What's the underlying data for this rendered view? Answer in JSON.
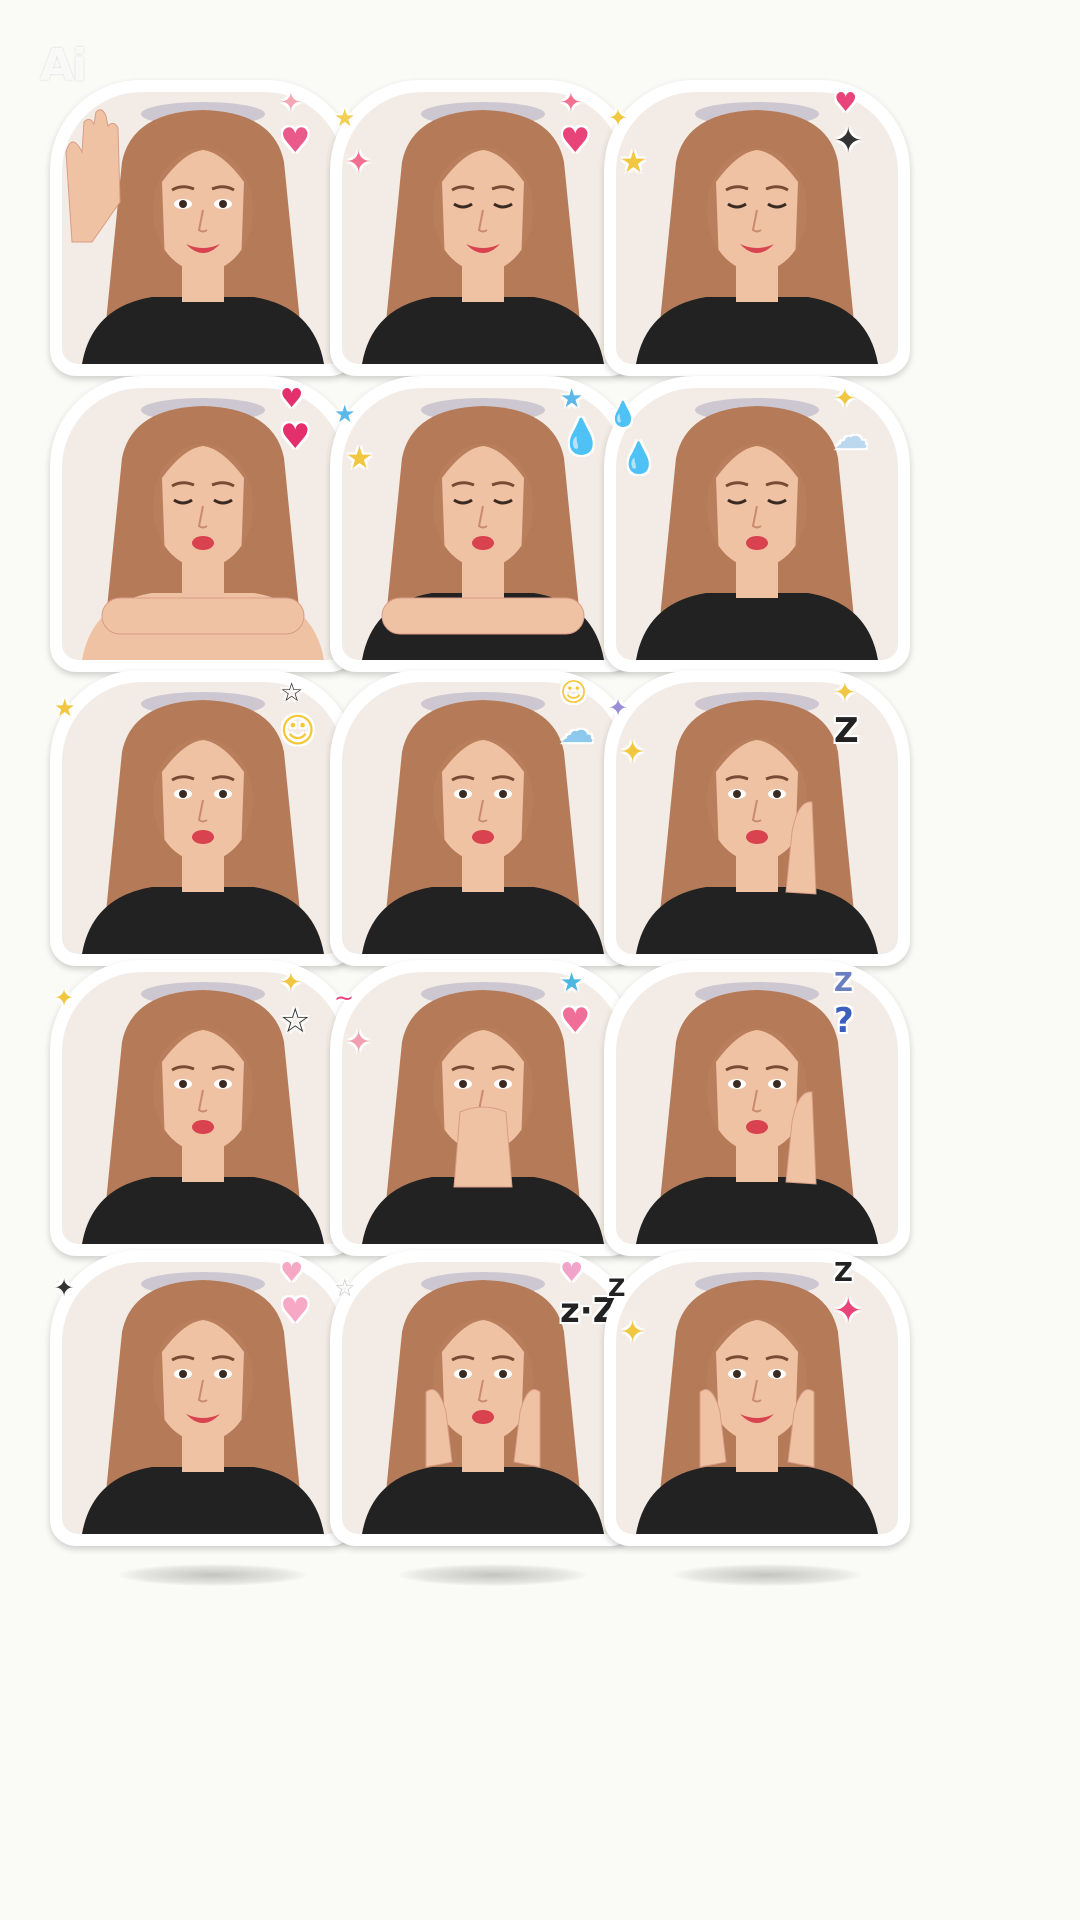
{
  "watermark": "Ai",
  "colors": {
    "background": "#fafaf6",
    "hair": "#b57b58",
    "skin": "#f0c2a4",
    "shirt": "#222222",
    "lips": "#d8434f"
  },
  "stickers": [
    {
      "row": 1,
      "col": 1,
      "expression": "waving-smile",
      "decorations": [
        {
          "icon": "star-icon",
          "glyph": "✦",
          "color": "#f5a8b4"
        },
        {
          "icon": "heart-icon",
          "glyph": "♥",
          "color": "#e95a8a"
        }
      ]
    },
    {
      "row": 1,
      "col": 2,
      "expression": "laughing",
      "decorations": [
        {
          "icon": "star-icon",
          "glyph": "✦",
          "color": "#f2708f"
        },
        {
          "icon": "heart-icon",
          "glyph": "♥",
          "color": "#e8447a"
        },
        {
          "icon": "star-icon",
          "glyph": "★",
          "color": "#f1cf54"
        },
        {
          "icon": "star-icon",
          "glyph": "✦",
          "color": "#f2708f"
        }
      ]
    },
    {
      "row": 1,
      "col": 3,
      "expression": "eyes-closed-smile",
      "decorations": [
        {
          "icon": "heart-icon",
          "glyph": "♥",
          "color": "#e8447a"
        },
        {
          "icon": "star-icon",
          "glyph": "✦",
          "color": "#333333"
        },
        {
          "icon": "star-icon",
          "glyph": "✦",
          "color": "#f1c640"
        },
        {
          "icon": "star-icon",
          "glyph": "★",
          "color": "#f1c640"
        }
      ]
    },
    {
      "row": 2,
      "col": 1,
      "expression": "wink-arms-crossed",
      "decorations": [
        {
          "icon": "heart-icon",
          "glyph": "♥",
          "color": "#e3306c"
        },
        {
          "icon": "heart-icon",
          "glyph": "♥",
          "color": "#e3306c"
        }
      ]
    },
    {
      "row": 2,
      "col": 2,
      "expression": "wink-kiss",
      "decorations": [
        {
          "icon": "star-icon",
          "glyph": "★",
          "color": "#5bb8e8"
        },
        {
          "icon": "droplet-icon",
          "glyph": "💧",
          "color": "#4cc1e6"
        },
        {
          "icon": "star-icon",
          "glyph": "★",
          "color": "#5bb8e8"
        },
        {
          "icon": "star-icon",
          "glyph": "★",
          "color": "#f1c640"
        }
      ]
    },
    {
      "row": 2,
      "col": 3,
      "expression": "wink-pout",
      "decorations": [
        {
          "icon": "star-icon",
          "glyph": "✦",
          "color": "#f1c640"
        },
        {
          "icon": "cloud-icon",
          "glyph": "☁",
          "color": "#bcd8ee"
        },
        {
          "icon": "droplet-icon",
          "glyph": "💧",
          "color": "#4cc1e6"
        },
        {
          "icon": "droplet-icon",
          "glyph": "💧",
          "color": "#4cc1e6"
        }
      ]
    },
    {
      "row": 3,
      "col": 1,
      "expression": "pout",
      "decorations": [
        {
          "icon": "star-icon",
          "glyph": "☆",
          "color": "#333333"
        },
        {
          "icon": "smiley-icon",
          "glyph": "☺",
          "color": "#f5c73a"
        },
        {
          "icon": "star-icon",
          "glyph": "★",
          "color": "#f1c640"
        }
      ]
    },
    {
      "row": 3,
      "col": 2,
      "expression": "frown-pout",
      "decorations": [
        {
          "icon": "smiley-icon",
          "glyph": "☺",
          "color": "#f5c73a"
        },
        {
          "icon": "rain-cloud-icon",
          "glyph": "☁",
          "color": "#8ec8ec"
        }
      ]
    },
    {
      "row": 3,
      "col": 3,
      "expression": "bored-hand-cheek",
      "decorations": [
        {
          "icon": "star-icon",
          "glyph": "✦",
          "color": "#f1c640"
        },
        {
          "icon": "sleep-z-icon",
          "glyph": "Z",
          "color": "#222222"
        },
        {
          "icon": "star-icon",
          "glyph": "✦",
          "color": "#9a8ed6"
        },
        {
          "icon": "star-icon",
          "glyph": "✦",
          "color": "#f1c640"
        }
      ]
    },
    {
      "row": 4,
      "col": 1,
      "expression": "neutral",
      "decorations": [
        {
          "icon": "star-icon",
          "glyph": "✦",
          "color": "#f1c640"
        },
        {
          "icon": "star-icon",
          "glyph": "☆",
          "color": "#333333"
        },
        {
          "icon": "star-icon",
          "glyph": "✦",
          "color": "#f1c640"
        }
      ]
    },
    {
      "row": 4,
      "col": 2,
      "expression": "hands-over-mouth",
      "decorations": [
        {
          "icon": "star-icon",
          "glyph": "★",
          "color": "#4cb8e0"
        },
        {
          "icon": "heart-icon",
          "glyph": "♥",
          "color": "#f06f98"
        },
        {
          "icon": "swirl-icon",
          "glyph": "~",
          "color": "#e8447a"
        },
        {
          "icon": "star-icon",
          "glyph": "✦",
          "color": "#f2a0b0"
        }
      ]
    },
    {
      "row": 4,
      "col": 3,
      "expression": "thinking",
      "decorations": [
        {
          "icon": "sleep-z-icon",
          "glyph": "Z",
          "color": "#6a7fc0"
        },
        {
          "icon": "question-icon",
          "glyph": "?",
          "color": "#3a5fbf"
        }
      ]
    },
    {
      "row": 5,
      "col": 1,
      "expression": "soft-smile",
      "decorations": [
        {
          "icon": "heart-icon",
          "glyph": "♥",
          "color": "#f6a8c4"
        },
        {
          "icon": "heart-icon",
          "glyph": "♥",
          "color": "#f6a8c4"
        },
        {
          "icon": "star-icon",
          "glyph": "✦",
          "color": "#333333"
        }
      ]
    },
    {
      "row": 5,
      "col": 2,
      "expression": "hands-on-cheeks",
      "decorations": [
        {
          "icon": "heart-icon",
          "glyph": "♥",
          "color": "#f1a3c9"
        },
        {
          "icon": "sleep-z-icon",
          "glyph": "z·Z",
          "color": "#222222"
        },
        {
          "icon": "star-icon",
          "glyph": "☆",
          "color": "#c9c9c9"
        }
      ]
    },
    {
      "row": 5,
      "col": 3,
      "expression": "hands-on-cheeks-smile",
      "decorations": [
        {
          "icon": "sleep-z-icon",
          "glyph": "Z",
          "color": "#222222"
        },
        {
          "icon": "star-icon",
          "glyph": "✦",
          "color": "#e8447a"
        },
        {
          "icon": "sleep-z-icon",
          "glyph": "Z",
          "color": "#222222"
        },
        {
          "icon": "star-icon",
          "glyph": "✦",
          "color": "#f1c640"
        }
      ]
    }
  ]
}
